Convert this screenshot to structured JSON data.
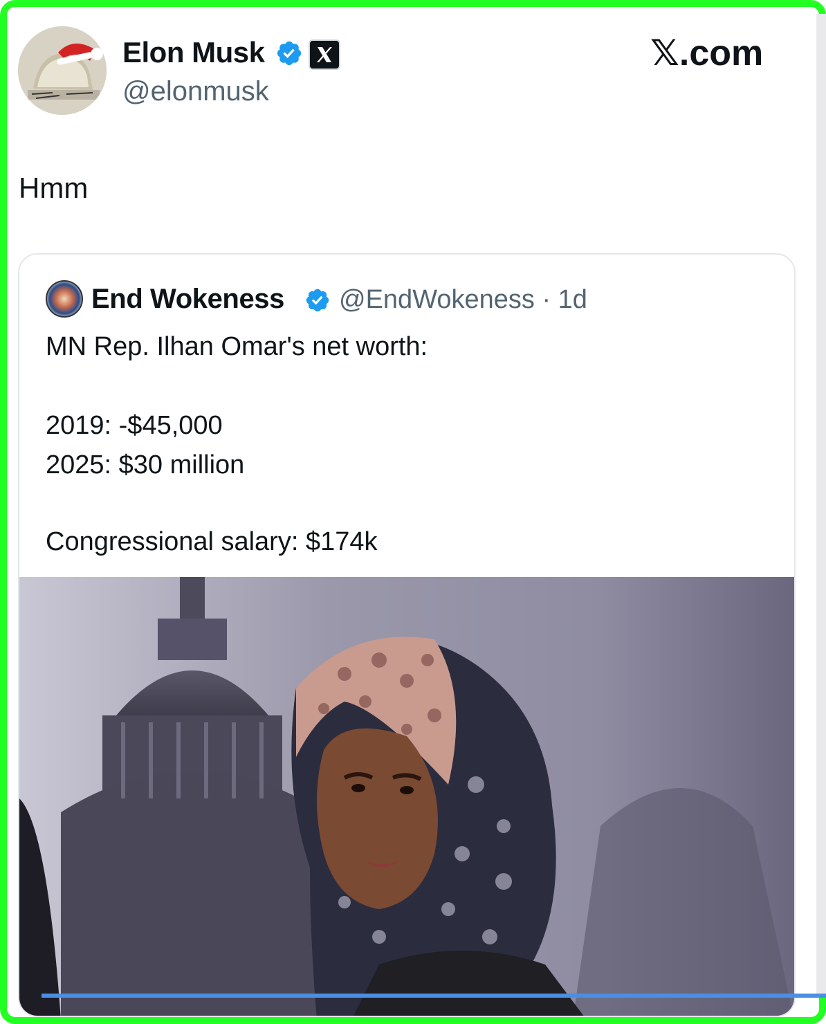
{
  "site": {
    "label": "𝕏.com"
  },
  "author": {
    "name": "Elon Musk",
    "handle": "@elonmusk",
    "avatar_icon": "avatar-santa-hat-icon",
    "verified_icon": "verified-badge-icon",
    "affiliate_icon": "x-logo-icon"
  },
  "tweet": {
    "text": "Hmm"
  },
  "quoted": {
    "name": "End Wokeness",
    "handle_time": "@EndWokeness · 1d",
    "lines": [
      "MN Rep. Ilhan Omar's net worth:",
      "2019: -$45,000",
      "2025: $30 million",
      "Congressional salary: $174k"
    ],
    "avatar_icon": "end-wokeness-avatar-icon",
    "verified_icon": "verified-badge-icon",
    "image_icon": "photo-person-capitol-icon"
  },
  "colors": {
    "frame": "#22ff22",
    "verified": "#1d9bf0",
    "text": "#0f1419",
    "secondary": "#536471"
  }
}
